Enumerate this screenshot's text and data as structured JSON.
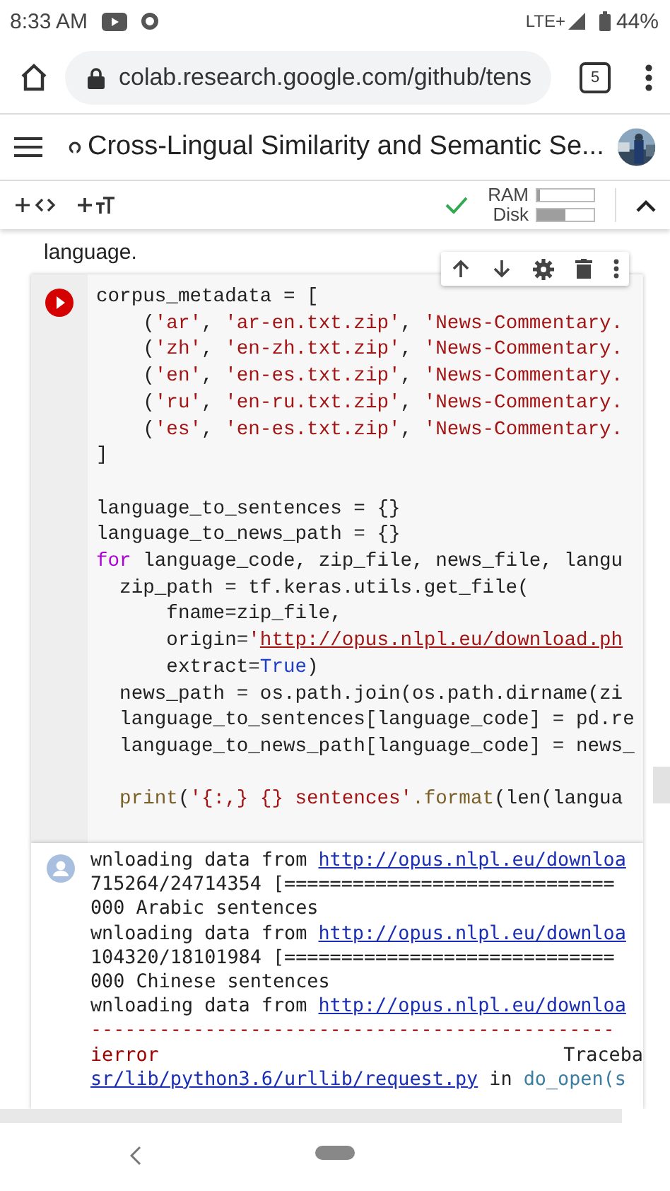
{
  "status_bar": {
    "time": "8:33 AM",
    "network": "LTE+",
    "battery": "44%"
  },
  "browser": {
    "url": "colab.research.google.com/github/tens",
    "tab_count": "5"
  },
  "notebook": {
    "title": "Cross-Lingual Similarity and Semantic Se...",
    "resources": [
      {
        "label": "RAM",
        "level": 0.05
      },
      {
        "label": "Disk",
        "level": 0.5
      }
    ],
    "connected": true
  },
  "text_cell": "language.",
  "code_cell": {
    "running": false,
    "blocks": [
      [
        [
          {
            "kind": "plain",
            "text": "corpus_metadata = ["
          }
        ],
        [
          {
            "kind": "plain",
            "text": "    ("
          },
          {
            "kind": "string",
            "text": "'ar'"
          },
          {
            "kind": "plain",
            "text": ", "
          },
          {
            "kind": "string",
            "text": "'ar-en.txt.zip'"
          },
          {
            "kind": "plain",
            "text": ", "
          },
          {
            "kind": "string",
            "text": "'News-Commentary."
          }
        ],
        [
          {
            "kind": "plain",
            "text": "    ("
          },
          {
            "kind": "string",
            "text": "'zh'"
          },
          {
            "kind": "plain",
            "text": ", "
          },
          {
            "kind": "string",
            "text": "'en-zh.txt.zip'"
          },
          {
            "kind": "plain",
            "text": ", "
          },
          {
            "kind": "string",
            "text": "'News-Commentary."
          }
        ],
        [
          {
            "kind": "plain",
            "text": "    ("
          },
          {
            "kind": "string",
            "text": "'en'"
          },
          {
            "kind": "plain",
            "text": ", "
          },
          {
            "kind": "string",
            "text": "'en-es.txt.zip'"
          },
          {
            "kind": "plain",
            "text": ", "
          },
          {
            "kind": "string",
            "text": "'News-Commentary."
          }
        ],
        [
          {
            "kind": "plain",
            "text": "    ("
          },
          {
            "kind": "string",
            "text": "'ru'"
          },
          {
            "kind": "plain",
            "text": ", "
          },
          {
            "kind": "string",
            "text": "'en-ru.txt.zip'"
          },
          {
            "kind": "plain",
            "text": ", "
          },
          {
            "kind": "string",
            "text": "'News-Commentary."
          }
        ],
        [
          {
            "kind": "plain",
            "text": "    ("
          },
          {
            "kind": "string",
            "text": "'es'"
          },
          {
            "kind": "plain",
            "text": ", "
          },
          {
            "kind": "string",
            "text": "'en-es.txt.zip'"
          },
          {
            "kind": "plain",
            "text": ", "
          },
          {
            "kind": "string",
            "text": "'News-Commentary."
          }
        ],
        [
          {
            "kind": "plain",
            "text": "]"
          }
        ]
      ],
      [
        [
          {
            "kind": "plain",
            "text": "language_to_sentences = {}"
          }
        ],
        [
          {
            "kind": "plain",
            "text": "language_to_news_path = {}"
          }
        ],
        [
          {
            "kind": "keyword",
            "text": "for"
          },
          {
            "kind": "plain",
            "text": " language_code, zip_file, news_file, langu"
          }
        ],
        [
          {
            "kind": "plain",
            "text": "  zip_path = tf.keras.utils.get_file("
          }
        ],
        [
          {
            "kind": "plain",
            "text": "      fname=zip_file,"
          }
        ],
        [
          {
            "kind": "plain",
            "text": "      origin="
          },
          {
            "kind": "string",
            "text": "'"
          },
          {
            "kind": "url",
            "text": "http://opus.nlpl.eu/download.ph"
          }
        ],
        [
          {
            "kind": "plain",
            "text": "      extract="
          },
          {
            "kind": "const",
            "text": "True"
          },
          {
            "kind": "plain",
            "text": ")"
          }
        ],
        [
          {
            "kind": "plain",
            "text": "  news_path = os.path.join(os.path.dirname(zi"
          }
        ],
        [
          {
            "kind": "plain",
            "text": "  language_to_sentences[language_code] = pd.re"
          }
        ],
        [
          {
            "kind": "plain",
            "text": "  language_to_news_path[language_code] = news_"
          }
        ]
      ],
      [
        [
          {
            "kind": "builtin",
            "text": "  print"
          },
          {
            "kind": "plain",
            "text": "("
          },
          {
            "kind": "string",
            "text": "'{:,} {} sentences'"
          },
          {
            "kind": "builtin",
            "text": ".format"
          },
          {
            "kind": "plain",
            "text": "(len(langua"
          }
        ]
      ]
    ]
  },
  "output": [
    [
      {
        "kind": "plain",
        "text": "wnloading data from "
      },
      {
        "kind": "link",
        "text": "http://opus.nlpl.eu/downloa"
      }
    ],
    [
      {
        "kind": "plain",
        "text": "715264/24714354 [============================="
      }
    ],
    [
      {
        "kind": "plain",
        "text": "000 Arabic sentences"
      }
    ],
    [
      {
        "kind": "plain",
        "text": "wnloading data from "
      },
      {
        "kind": "link",
        "text": "http://opus.nlpl.eu/downloa"
      }
    ],
    [
      {
        "kind": "plain",
        "text": "104320/18101984 [============================="
      }
    ],
    [
      {
        "kind": "plain",
        "text": "000 Chinese sentences"
      }
    ],
    [
      {
        "kind": "plain",
        "text": "wnloading data from "
      },
      {
        "kind": "link",
        "text": "http://opus.nlpl.eu/downloa"
      }
    ],
    [
      {
        "kind": "error",
        "text": "----------------------------------------------"
      }
    ],
    [
      {
        "kind": "error",
        "text": "ierror"
      },
      {
        "kind": "traceback",
        "text": "Traceba"
      }
    ],
    [
      {
        "kind": "link",
        "text": "sr/lib/python3.6/urllib/request.py"
      },
      {
        "kind": "plain",
        "text": " in "
      },
      {
        "kind": "func",
        "text": "do_open(s"
      }
    ]
  ]
}
